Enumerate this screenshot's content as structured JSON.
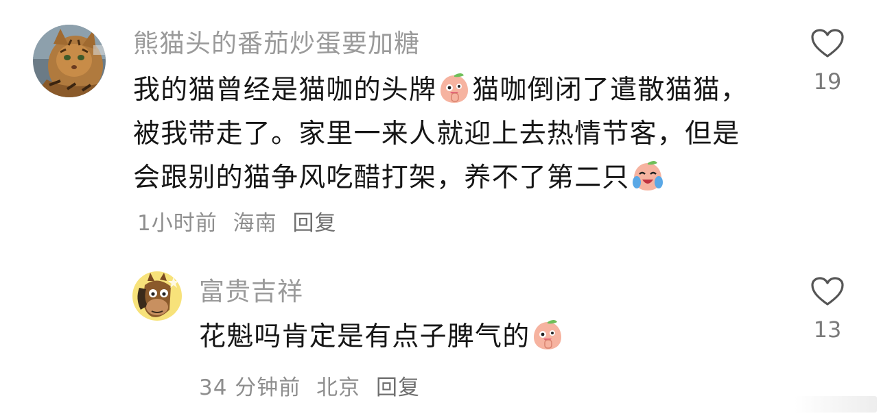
{
  "comments": [
    {
      "username": "熊猫头的番茄炒蛋要加糖",
      "text_part1": "我的猫曾经是猫咖的头牌",
      "text_part2": "猫咖倒闭了遣散猫猫，被我带走了。家里一来人就迎上去热情节客，但是会跟别的猫争风吃醋打架，养不了第二只",
      "time": "1小时前",
      "location": "海南",
      "reply_label": "回复",
      "like_count": "19",
      "avatar_icon": "tabby-cat-avatar",
      "emojis": [
        "peach-thinking-emoji",
        "peach-crying-emoji"
      ]
    },
    {
      "username": "富贵吉祥",
      "text": "花魁吗肯定是有点子脾气的",
      "time": "34 分钟前",
      "location": "北京",
      "reply_label": "回复",
      "like_count": "13",
      "avatar_icon": "cartoon-horse-avatar",
      "emojis": [
        "peach-thinking-emoji"
      ]
    }
  ],
  "colors": {
    "username": "#9a9a9a",
    "text": "#161616",
    "meta": "#8e8e8e",
    "heart_outline": "#555555",
    "peach": "#f4a58f"
  }
}
